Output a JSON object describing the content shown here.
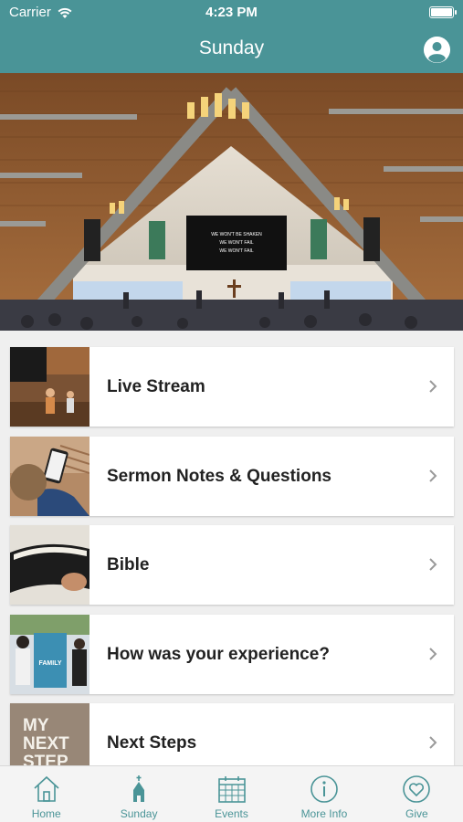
{
  "status_bar": {
    "carrier": "Carrier",
    "time": "4:23 PM"
  },
  "nav": {
    "title": "Sunday",
    "profile_icon": "user-circle-icon"
  },
  "hero": {
    "screen_lines": [
      "WE WON'T BE SHAKEN",
      "WE WON'T FAIL",
      "WE WON'T FAIL"
    ]
  },
  "menu": {
    "items": [
      {
        "label": "Live Stream",
        "thumb": "stage-photo"
      },
      {
        "label": "Sermon Notes & Questions",
        "thumb": "phone-in-hand-photo"
      },
      {
        "label": "Bible",
        "thumb": "open-bible-photo"
      },
      {
        "label": "How was your experience?",
        "thumb": "people-photo"
      },
      {
        "label": "Next Steps",
        "thumb": "my-next-step-sign"
      }
    ],
    "next_steps_sign": [
      "MY",
      "NEXT",
      "STEP"
    ],
    "experience_sign": "FAMILY"
  },
  "tabs": [
    {
      "label": "Home",
      "icon": "house-icon"
    },
    {
      "label": "Sunday",
      "icon": "church-icon"
    },
    {
      "label": "Events",
      "icon": "calendar-icon"
    },
    {
      "label": "More Info",
      "icon": "info-circle-icon"
    },
    {
      "label": "Give",
      "icon": "heart-circle-icon"
    }
  ],
  "colors": {
    "accent": "#4a9497",
    "tab_background": "#f4f4f4",
    "page_background": "#efefef"
  }
}
